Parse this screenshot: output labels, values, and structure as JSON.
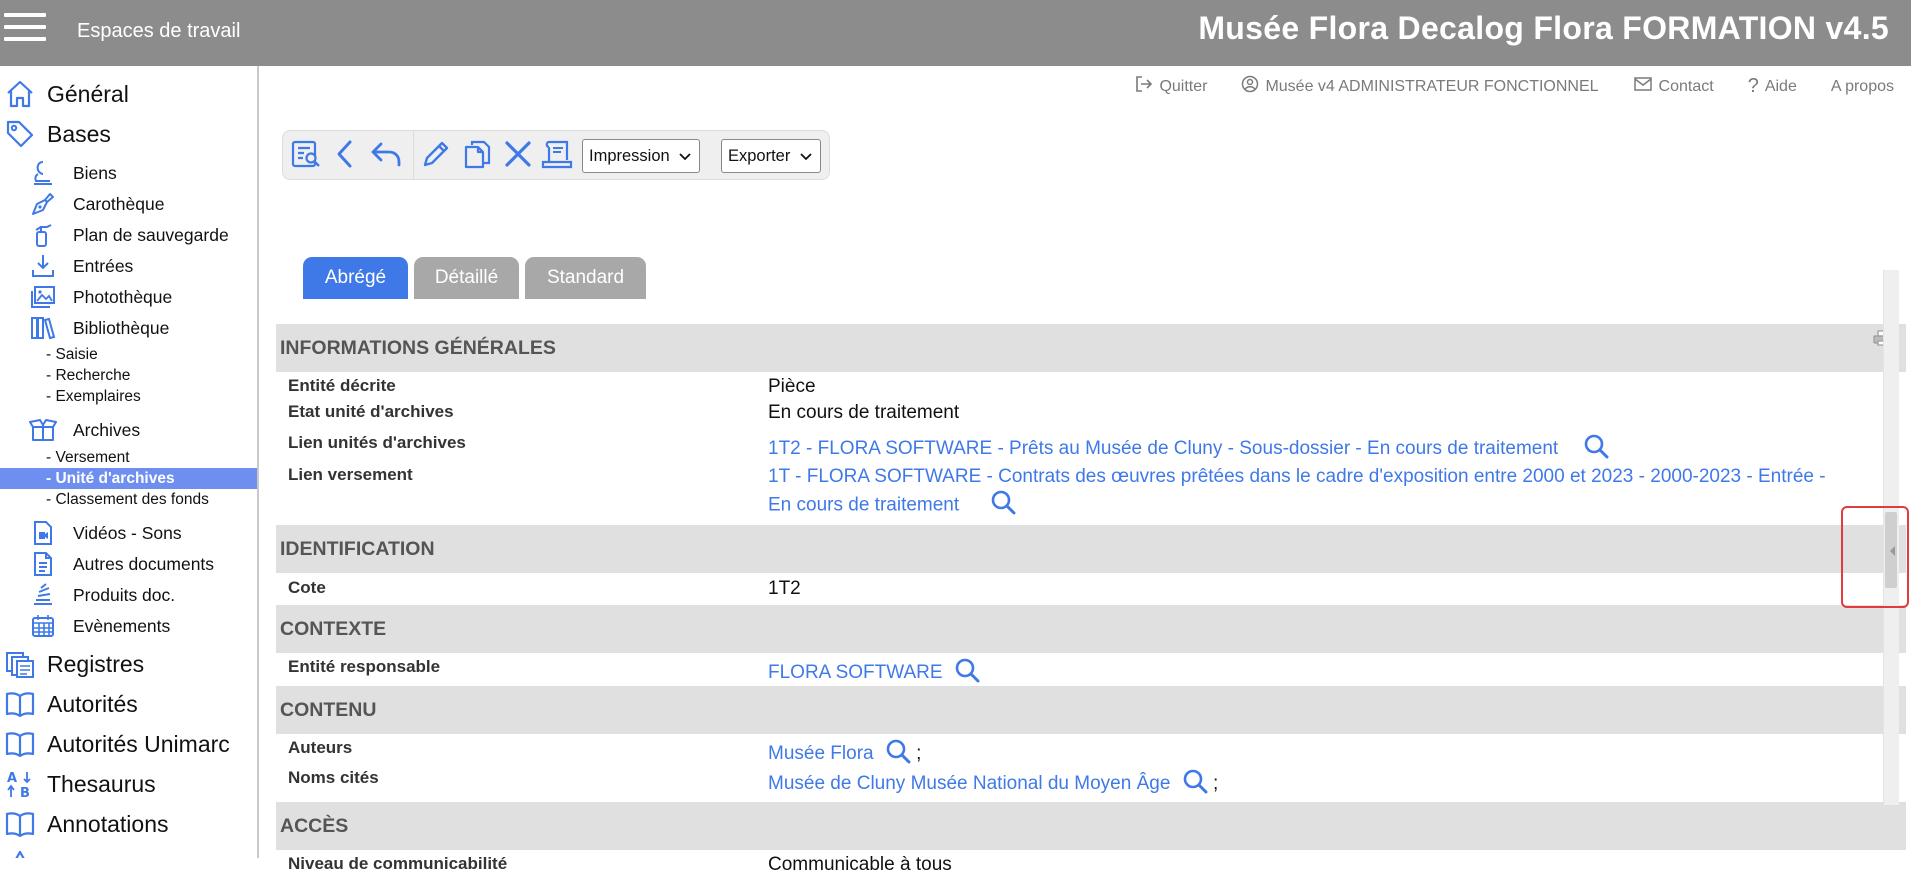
{
  "header": {
    "menu_icon": "hamburger-icon",
    "workspaces": "Espaces de travail",
    "title": "Musée Flora Decalog Flora FORMATION v4.5",
    "bg_color": "#8c8c8c"
  },
  "sidebar": {
    "accent": "#3f79e8",
    "general": "Général",
    "bases": "Bases",
    "biens": "Biens",
    "carotheque": "Carothèque",
    "plan": "Plan de sauvegarde",
    "entrees": "Entrées",
    "phototheque": "Photothèque",
    "bibliotheque": "Bibliothèque",
    "saisie": "- Saisie",
    "recherche": "- Recherche",
    "exemplaires": "- Exemplaires",
    "archives": "Archives",
    "versement": "- Versement",
    "unite": "- Unité d'archives",
    "classement": "- Classement des fonds",
    "videos": "Vidéos - Sons",
    "autres": "Autres documents",
    "produits": "Produits doc.",
    "evenements": "Evènements",
    "registres": "Registres",
    "autorites": "Autorités",
    "autorites_unimarc": "Autorités Unimarc",
    "thesaurus": "Thesaurus",
    "annotations": "Annotations"
  },
  "utilbar": {
    "quit": "Quitter",
    "user": "Musée v4 ADMINISTRATEUR FONCTIONNEL",
    "contact": "Contact",
    "help": "Aide",
    "about": "A propos"
  },
  "toolbar": {
    "print_select": "Impression",
    "export_select": "Exporter"
  },
  "tabs": {
    "abrege": "Abrégé",
    "detaille": "Détaillé",
    "standard": "Standard",
    "active_color": "#3f79e8",
    "inactive_color": "#a8a8a8"
  },
  "sections": {
    "general": {
      "title": "INFORMATIONS GÉNÉRALES",
      "entite_label": "Entité décrite",
      "entite_value": "Pièce",
      "etat_label": "Etat unité d'archives",
      "etat_value": "En cours de traitement",
      "lien_ua_label": "Lien unités d'archives",
      "lien_ua_value": "1T2 - FLORA SOFTWARE - Prêts au Musée de Cluny - Sous-dossier - En cours de traitement",
      "lien_vers_label": "Lien versement",
      "lien_vers_value_1": "1T - FLORA SOFTWARE - Contrats des œuvres prêtées dans le cadre d'exposition entre 2000 et 2023 - 2000-2023 - Entrée -",
      "lien_vers_value_2": "En cours de traitement"
    },
    "identification": {
      "title": "IDENTIFICATION",
      "cote_label": "Cote",
      "cote_value": "1T2"
    },
    "contexte": {
      "title": "CONTEXTE",
      "resp_label": "Entité responsable",
      "resp_value": "FLORA SOFTWARE"
    },
    "contenu": {
      "title": "CONTENU",
      "auteurs_label": "Auteurs",
      "auteurs_value": "Musée Flora",
      "noms_label": "Noms cités",
      "noms_value": "Musée de Cluny Musée National du Moyen Âge",
      "separator": ";"
    },
    "acces": {
      "title": "ACCÈS",
      "niveau_label": "Niveau de communicabilité",
      "niveau_value": "Communicable à tous"
    }
  }
}
